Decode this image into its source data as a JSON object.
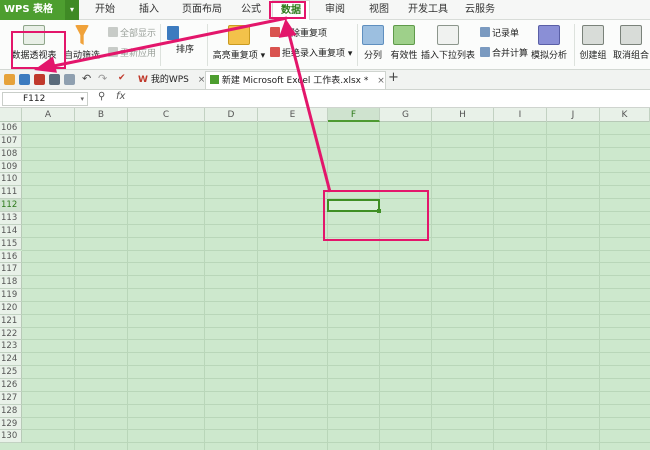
{
  "app": {
    "name": "WPS 表格"
  },
  "menu": {
    "tabs": [
      "开始",
      "插入",
      "页面布局",
      "公式",
      "数据",
      "审阅",
      "视图",
      "开发工具",
      "云服务"
    ],
    "active": "数据"
  },
  "ribbon": {
    "pivot_table": "数据透视表",
    "auto_filter": "自动筛选",
    "show_all": "全部显示",
    "reapply": "重新应用",
    "sort": "排序",
    "highlight_duplicates": "高亮重复项",
    "delete_duplicates": "删除重复项",
    "reject_duplicates": "拒绝录入重复项",
    "split_columns": "分列",
    "validity": "有效性",
    "insert_dropdown": "插入下拉列表",
    "record_form": "记录单",
    "consolidate": "合并计算",
    "simulation": "模拟分析",
    "create_group": "创建组",
    "ungroup": "取消组合"
  },
  "doc_tabs": [
    {
      "label": "我的WPS"
    },
    {
      "label": "新建 Microsoft Excel 工作表.xlsx *"
    }
  ],
  "formula_bar": {
    "name_box": "F112",
    "fx": "fx",
    "content": ""
  },
  "grid": {
    "columns": [
      "A",
      "B",
      "C",
      "D",
      "E",
      "F",
      "G",
      "H",
      "I",
      "J",
      "K"
    ],
    "rows": [
      "106",
      "107",
      "108",
      "109",
      "110",
      "111",
      "112",
      "113",
      "114",
      "115",
      "116",
      "117",
      "118",
      "119",
      "120",
      "121",
      "122",
      "123",
      "124",
      "125",
      "126",
      "127",
      "128",
      "129",
      "130"
    ],
    "active_cell": "F112",
    "selected_column": "F",
    "selected_row": "112"
  },
  "colors": {
    "brand": "#4d9e2f",
    "grid_fill": "#cde8cd",
    "annotation": "#e3166b"
  }
}
